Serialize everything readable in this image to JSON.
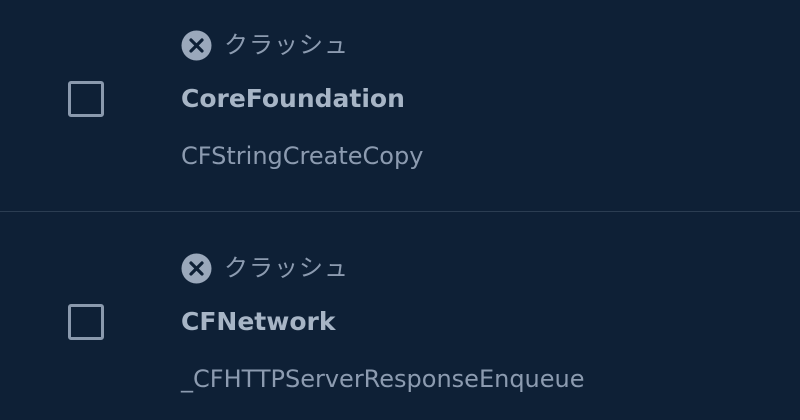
{
  "issues": [
    {
      "status_icon": "close-circle-icon",
      "status_label": "クラッシュ",
      "library": "CoreFoundation",
      "symbol": "CFStringCreateCopy",
      "checked": false
    },
    {
      "status_icon": "close-circle-icon",
      "status_label": "クラッシュ",
      "library": "CFNetwork",
      "symbol": "_CFHTTPServerResponseEnqueue",
      "checked": false
    }
  ],
  "colors": {
    "background": "#0e2036",
    "divider": "#2b3d52",
    "primary_text": "#a7b5c6",
    "secondary_text": "#8c9bb0",
    "icon": "#9aa8bb"
  }
}
